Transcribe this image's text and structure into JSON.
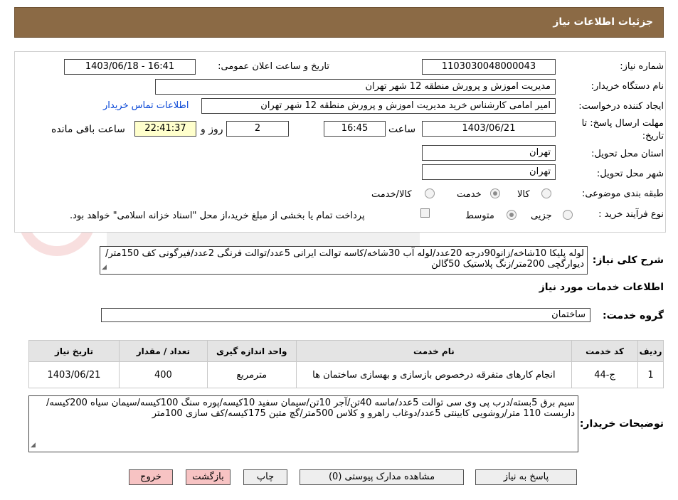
{
  "header": {
    "title": "جزئیات اطلاعات نیاز"
  },
  "form": {
    "need_number_label": "شماره نیاز:",
    "need_number": "1103030048000043",
    "announce_label": "تاریخ و ساعت اعلان عمومی:",
    "announce_value": "1403/06/18 - 16:41",
    "buyer_org_label": "نام دستگاه خریدار:",
    "buyer_org": "مدیریت اموزش و پرورش منطقه 12 شهر تهران",
    "creator_label": "ایجاد کننده درخواست:",
    "creator": "امیر امامی کارشناس خرید مدیریت اموزش و پرورش منطقه 12 شهر تهران",
    "contact_link": "اطلاعات تماس خریدار",
    "deadline_label_1": "مهلت ارسال پاسخ: تا",
    "deadline_label_2": "تاریخ:",
    "deadline_date": "1403/06/21",
    "time_label": "ساعت",
    "deadline_time": "16:45",
    "days_value": "2",
    "days_label": "روز و",
    "remaining_time": "22:41:37",
    "remaining_label": "ساعت باقی مانده",
    "province_label": "استان محل تحویل:",
    "province": "تهران",
    "city_label": "شهر محل تحویل:",
    "city": "تهران",
    "category_label": "طبقه بندی موضوعی:",
    "category_options": [
      "کالا",
      "خدمت",
      "کالا/خدمت"
    ],
    "process_label": "نوع فرآیند خرید :",
    "process_options": [
      "جزیی",
      "متوسط"
    ],
    "payment_note": "پرداخت تمام یا بخشی از مبلغ خرید،از محل \"اسناد خزانه اسلامی\" خواهد بود."
  },
  "summary": {
    "label": "شرح کلی نیاز:",
    "text": "لوله پلیکا 10شاخه/زانو90درجه 20عدد/لوله آب 30شاخه/کاسه توالت ایرانی 5عدد/توالت فرنگی 2عدد/فیرگونی کف 150متر/دیوارگچی 200متر/زنگ پلاستیک 50گالن"
  },
  "services": {
    "section_title": "اطلاعات خدمات مورد نیاز",
    "group_label": "گروه خدمت:",
    "group_value": "ساختمان",
    "columns": [
      "ردیف",
      "کد خدمت",
      "نام خدمت",
      "واحد اندازه گیری",
      "تعداد / مقدار",
      "تاریخ نیاز"
    ],
    "rows": [
      [
        "1",
        "ج-44",
        "انجام کارهای متفرقه درخصوص بازسازی و بهسازی ساختمان ها",
        "مترمربع",
        "400",
        "1403/06/21"
      ]
    ]
  },
  "buyer_notes": {
    "label": "توضیحات خریدار:",
    "text": "سیم برق 5بسته/درب پی وی سی توالت 5عدد/ماسه 40تن/آجر 10تن/سیمان سفید 10کیسه/پوره سنگ 100کیسه/سیمان سیاه 200کیسه/داربست 110 متر/روشویی کابینتی 5عدد/دوغاب راهرو و کلاس 500متر/گچ متین 175کیسه/کف سازی 100متر"
  },
  "buttons": {
    "reply": "پاسخ به نیاز",
    "attachments": "مشاهده مدارک پیوستی (0)",
    "print": "چاپ",
    "back": "بازگشت",
    "exit": "خروج"
  },
  "colors": {
    "header_bg": "#8b6a45",
    "link": "#0645d6",
    "exit_bg": "#f7c3c3"
  }
}
